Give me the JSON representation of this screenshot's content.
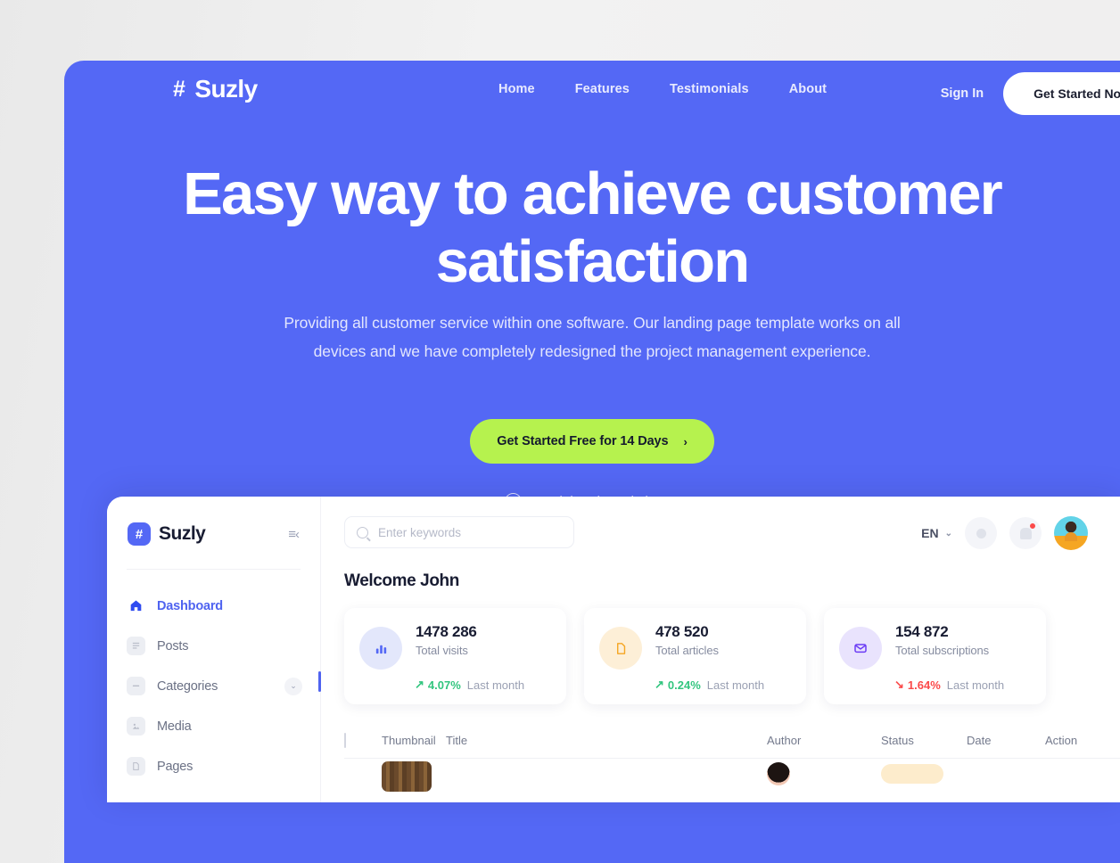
{
  "hero": {
    "brand": {
      "hash": "#",
      "name": "Suzly"
    },
    "nav_links": [
      {
        "label": "Home"
      },
      {
        "label": "Features"
      },
      {
        "label": "Testimonials"
      },
      {
        "label": "About"
      }
    ],
    "signin_label": "Sign In",
    "get_started_label": "Get Started Now",
    "title": "Easy way to achieve customer satisfaction",
    "subtitle": "Providing all customer service within one software. Our landing page template works on all devices and we have completely redesigned the project management experience.",
    "cta_label": "Get Started Free for 14 Days",
    "cta_chevron": "›",
    "watch_label": "Watch how it can help you",
    "bg_color": "#5468f5",
    "cta_color": "#b6f24e"
  },
  "dashboard": {
    "logo": {
      "badge": "#",
      "name": "Suzly"
    },
    "collapse_icon": "≡‹",
    "sidebar_items": [
      {
        "label": "Dashboard",
        "icon": "home-icon",
        "active": true,
        "has_chevron": false
      },
      {
        "label": "Posts",
        "icon": "posts-icon",
        "active": false,
        "has_chevron": false
      },
      {
        "label": "Categories",
        "icon": "categories-icon",
        "active": false,
        "has_chevron": true
      },
      {
        "label": "Media",
        "icon": "media-icon",
        "active": false,
        "has_chevron": false
      },
      {
        "label": "Pages",
        "icon": "pages-icon",
        "active": false,
        "has_chevron": false
      }
    ],
    "chevron_glyph": "⌄",
    "search": {
      "placeholder": "Enter keywords",
      "value": ""
    },
    "language": {
      "value": "EN",
      "chevron": "⌄"
    },
    "welcome": "Welcome John",
    "stats": [
      {
        "value": "1478 286",
        "label": "Total visits",
        "trend_icon": "↗",
        "trend": "4.07%",
        "direction": "up",
        "period": "Last month",
        "icon": "bar-chart-icon",
        "icon_bg": "#e3e7fb",
        "icon_color": "#5468f5"
      },
      {
        "value": "478 520",
        "label": "Total articles",
        "trend_icon": "↗",
        "trend": "0.24%",
        "direction": "up",
        "period": "Last month",
        "icon": "document-icon",
        "icon_bg": "#fdefd7",
        "icon_color": "#f5a623"
      },
      {
        "value": "154 872",
        "label": "Total subscriptions",
        "trend_icon": "↘",
        "trend": "1.64%",
        "direction": "down",
        "period": "Last month",
        "icon": "envelope-icon",
        "icon_bg": "#e9e3fd",
        "icon_color": "#6c3df5"
      }
    ],
    "table": {
      "columns": {
        "thumbnail": "Thumbnail",
        "title": "Title",
        "author": "Author",
        "status": "Status",
        "date": "Date",
        "action": "Action"
      }
    }
  }
}
